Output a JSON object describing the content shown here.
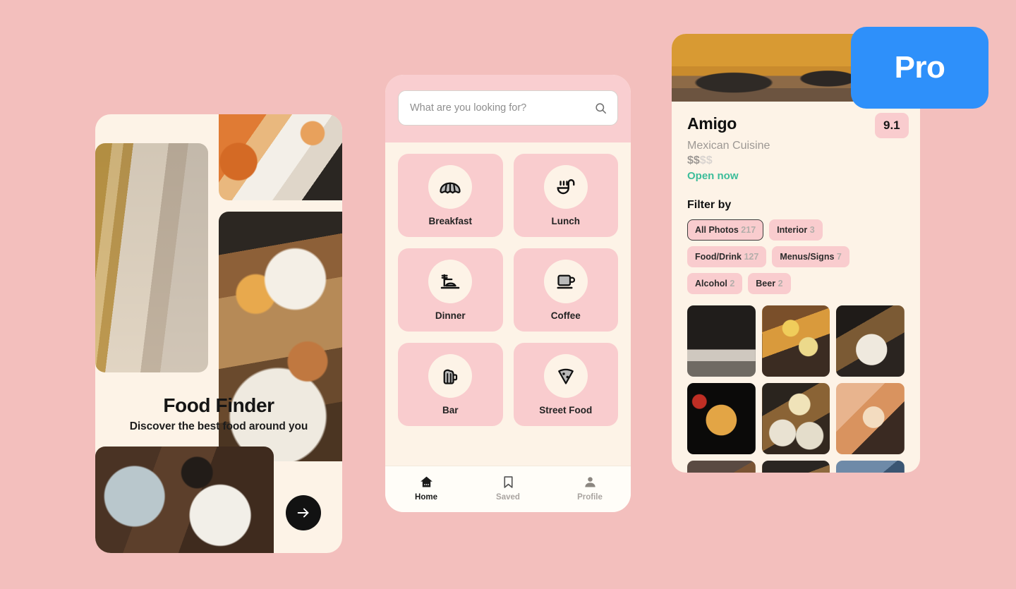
{
  "theme": {
    "page_background": "#f3bfbd",
    "card_background": "#fdf3e7",
    "pink_accent": "#f9ccce",
    "header_pink": "#f9ced0",
    "brand_blue": "#2e90fa",
    "open_green": "#3cbd9a",
    "dark": "#121212"
  },
  "pro_badge": {
    "label": "Pro"
  },
  "intro_card": {
    "title": "Food Finder",
    "subtitle": "Discover the best food around you",
    "next_button_icon": "arrow-right-icon",
    "photos": [
      {
        "name": "storefront-cafe-photo",
        "alt": "Parisian cafe storefront with bistro chairs"
      },
      {
        "name": "pizza-sharing-photo",
        "alt": "Hands sharing pizza and appetizers on a table"
      },
      {
        "name": "table-spread-photo",
        "alt": "Table spread with bowls, copper mug and cocktails"
      },
      {
        "name": "brunch-overhead-photo",
        "alt": "Overhead brunch plates, coffee and cutlery"
      }
    ]
  },
  "phone": {
    "search": {
      "placeholder": "What are you looking for?",
      "value": "",
      "icon": "search-icon"
    },
    "categories": [
      {
        "label": "Breakfast",
        "icon": "croissant-icon"
      },
      {
        "label": "Lunch",
        "icon": "soup-ladle-icon"
      },
      {
        "label": "Dinner",
        "icon": "dinner-plate-icon"
      },
      {
        "label": "Coffee",
        "icon": "coffee-cup-icon"
      },
      {
        "label": "Bar",
        "icon": "beer-mug-icon"
      },
      {
        "label": "Street Food",
        "icon": "pizza-slice-icon"
      }
    ],
    "tabs": [
      {
        "label": "Home",
        "icon": "home-icon",
        "active": true
      },
      {
        "label": "Saved",
        "icon": "bookmark-icon",
        "active": false
      },
      {
        "label": "Profile",
        "icon": "person-icon",
        "active": false
      }
    ]
  },
  "restaurant": {
    "hero_photo": {
      "name": "restaurant-interior-photo",
      "alt": "Restaurant interior with tan leather banquette seating"
    },
    "name": "Amigo",
    "cuisine": "Mexican Cuisine",
    "price_filled": "$$",
    "price_empty": "$$",
    "status": "Open now",
    "rating": "9.1",
    "filter_title": "Filter by",
    "filters": [
      {
        "label": "All Photos",
        "count": "217",
        "selected": true
      },
      {
        "label": "Interior",
        "count": "3",
        "selected": false
      },
      {
        "label": "Food/Drink",
        "count": "127",
        "selected": false
      },
      {
        "label": "Menus/Signs",
        "count": "7",
        "selected": false
      },
      {
        "label": "Alcohol",
        "count": "2",
        "selected": false
      },
      {
        "label": "Beer",
        "count": "2",
        "selected": false
      }
    ],
    "photos": [
      {
        "name": "chalkboard-menu-photo",
        "alt": "Chalkboard menu board behind a bar"
      },
      {
        "name": "brunch-plates-photo",
        "alt": "Plates of food with a margarita"
      },
      {
        "name": "mexican-platter-photo",
        "alt": "Large mexican platter with tacos and sides"
      },
      {
        "name": "nachos-skillet-photo",
        "alt": "Loaded nachos in a black skillet"
      },
      {
        "name": "tacos-pour-photo",
        "alt": "Tacos with sauce being poured over"
      },
      {
        "name": "cheers-drinks-photo",
        "alt": "Hands toasting with cocktails"
      },
      {
        "name": "grilled-meat-photo",
        "alt": "Close up of grilled meat"
      },
      {
        "name": "beer-and-food-photo",
        "alt": "Beers and shared plates on a table"
      },
      {
        "name": "street-food-hands-photo",
        "alt": "Hands holding street food"
      }
    ]
  }
}
